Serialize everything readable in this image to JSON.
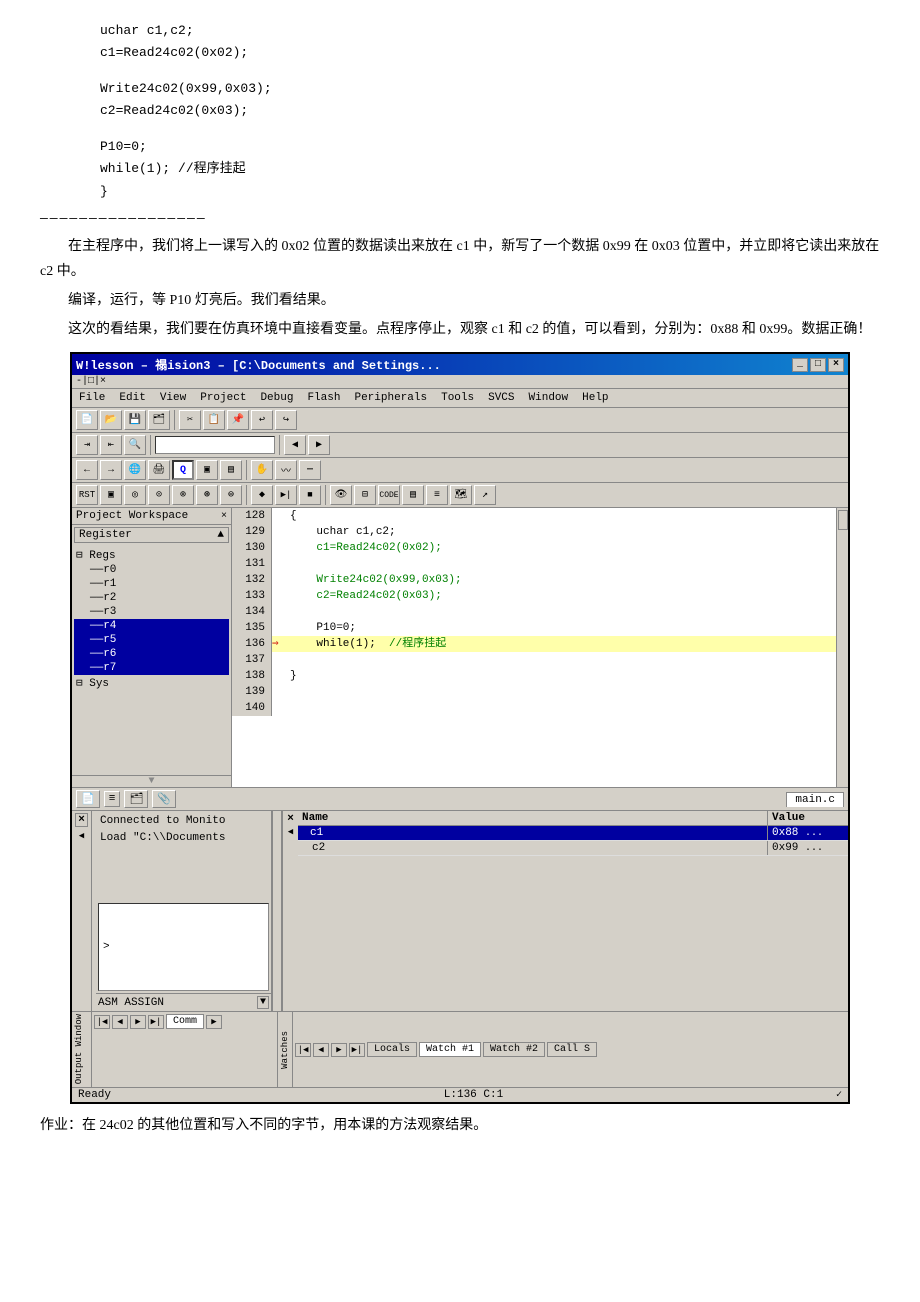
{
  "topCode": {
    "lines": [
      "uchar c1,c2;",
      "c1=Read24c02(0x02);",
      "",
      "",
      "Write24c02(0x99,0x03);",
      "c2=Read24c02(0x03);",
      "",
      "",
      "P10=0;",
      "while(1);   //程序挂起",
      "}"
    ]
  },
  "separator": "—————————————————",
  "paragraphs": [
    "在主程序中，我们将上一课写入的 0x02 位置的数据读出来放在 c1 中，新写了一个数据 0x99 在 0x03 位置中，并立即将它读出来放在 c2 中。",
    "编译，运行，等 P10 灯亮后。我们看结果。",
    "这次的看结果，我们要在仿真环境中直接看变量。点程序停止，观察 c1 和 c2 的值，可以看到，分别为：0x88 和 0x99。数据正确！"
  ],
  "ide": {
    "title": "W!lesson  – 禢ision3 – [C:\\Documents and Settings...",
    "menuItems": [
      "File",
      "Edit",
      "View",
      "Project",
      "Debug",
      "Flash",
      "Peripherals",
      "Tools",
      "SVCS",
      "Window",
      "Help"
    ],
    "projectPanel": {
      "title": "Project Workspace",
      "closeBtn": "×",
      "registerLabel": "Register",
      "treeItems": [
        {
          "label": "Regs",
          "type": "parent"
        },
        {
          "label": "r0",
          "type": "leaf"
        },
        {
          "label": "r1",
          "type": "leaf"
        },
        {
          "label": "r2",
          "type": "leaf"
        },
        {
          "label": "r3",
          "type": "leaf"
        },
        {
          "label": "r4",
          "type": "leaf",
          "selected": true
        },
        {
          "label": "r5",
          "type": "leaf",
          "selected": true
        },
        {
          "label": "r6",
          "type": "leaf",
          "selected": true
        },
        {
          "label": "r7",
          "type": "leaf",
          "selected": true
        },
        {
          "label": "Sys",
          "type": "parent"
        }
      ]
    },
    "codeLines": [
      {
        "num": 128,
        "arrow": false,
        "content": "{"
      },
      {
        "num": 129,
        "arrow": false,
        "content": "    uchar c1,c2;"
      },
      {
        "num": 130,
        "arrow": false,
        "content": "    c1=Read24c02(0x02);"
      },
      {
        "num": 131,
        "arrow": false,
        "content": ""
      },
      {
        "num": 132,
        "arrow": false,
        "content": "    Write24c02(0x99,0x03);"
      },
      {
        "num": 133,
        "arrow": false,
        "content": "    c2=Read24c02(0x03);"
      },
      {
        "num": 134,
        "arrow": false,
        "content": ""
      },
      {
        "num": 135,
        "arrow": false,
        "content": "    P10=0;"
      },
      {
        "num": 136,
        "arrow": true,
        "content": "    while(1);  //程序挂起"
      },
      {
        "num": 137,
        "arrow": false,
        "content": ""
      },
      {
        "num": 138,
        "arrow": false,
        "content": "}"
      },
      {
        "num": 139,
        "arrow": false,
        "content": ""
      },
      {
        "num": 140,
        "arrow": false,
        "content": ""
      }
    ],
    "fileTab": "main.c",
    "outputText": [
      "Connected to Monito",
      "Load \"C:\\\\Documents"
    ],
    "asmLabel": "ASM ASSIGN",
    "watches": {
      "columns": [
        "Name",
        "Value"
      ],
      "rows": [
        {
          "name": "c1",
          "value": "0x88",
          "selected": true
        },
        {
          "name": "c2",
          "value": "0x99",
          "selected": false
        }
      ]
    },
    "bottomTabs": {
      "output": [
        "Locals",
        "Watch #1",
        "Watch #2",
        "Call S"
      ],
      "comm": [
        "Comm"
      ]
    },
    "statusbar": {
      "left": "Ready",
      "right": "L:136 C:1"
    }
  },
  "homework": "作业：在 24c02 的其他位置和写入不同的字节，用本课的方法观察结果。"
}
